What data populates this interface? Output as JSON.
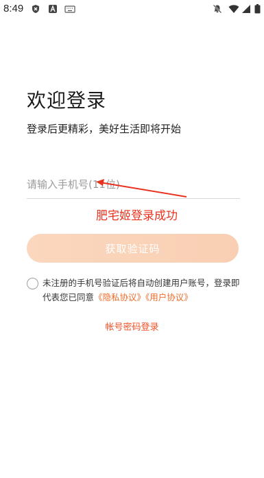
{
  "status_bar": {
    "time": "8:49",
    "icons": [
      "shield-x-icon",
      "font-a-icon",
      "keyboard-icon",
      "notifications-off-icon",
      "wifi-icon",
      "signal-icon",
      "battery-icon"
    ]
  },
  "login": {
    "title": "欢迎登录",
    "subtitle": "登录后更精彩，美好生活即将开始",
    "phone_placeholder": "请输入手机号(11位)",
    "verify_button": "获取验证码",
    "agreement_text": "未注册的手机号验证后将自动创建用户账号，登录即代表您已同意",
    "privacy_link": "《隐私协议》",
    "user_link": "《用户协议》",
    "password_login": "帐号密码登录"
  },
  "annotation": {
    "text": "肥宅姬登录成功",
    "color": "#e8321e"
  },
  "colors": {
    "accent": "#f06b2a",
    "button_bg": "#fbd7be"
  }
}
